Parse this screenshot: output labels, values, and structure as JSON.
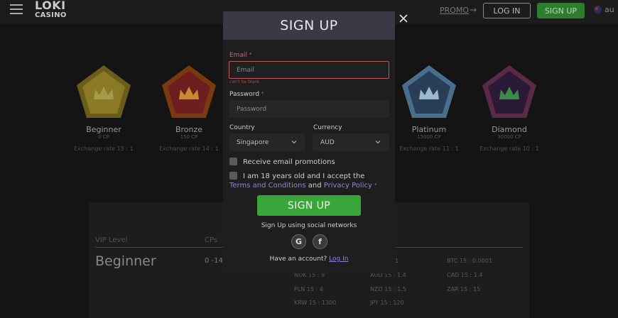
{
  "header": {
    "logo_line1": "LOKI",
    "logo_line2": "CASINO",
    "promo": "PROMO",
    "promo_arrow": "→",
    "login": "LOG IN",
    "signup": "SIGN UP",
    "language": "au"
  },
  "badges": [
    {
      "name": "Beginner",
      "cp": "0 CP",
      "rate": "Exchange rate 15 : 1",
      "color": "#8a7a20"
    },
    {
      "name": "Bronze",
      "cp": "150 CP",
      "rate": "Exchange rate 14 : 1",
      "color": "#9a4a14"
    },
    {
      "name": "Platinum",
      "cp": "15000 CP",
      "rate": "Exchange rate 11 : 1",
      "color": "#5a8ab0"
    },
    {
      "name": "Diamond",
      "cp": "30000 CP",
      "rate": "Exchange rate 10 : 1",
      "color": "#6a2a50"
    }
  ],
  "vip": {
    "header_level": "VIP Level",
    "header_cps": "CPs",
    "level": "Beginner",
    "cps": "0 -149",
    "rates": [
      "1",
      "BTC 15 : 0.0001",
      "NOK 15 : 9",
      "AUD 15 : 1.4",
      "CAD 15 : 1.4",
      "PLN 15 : 4",
      "NZD 15 : 1.5",
      "ZAR 15 : 15",
      "KRW 15 : 1300",
      "JPY 15 : 120"
    ]
  },
  "modal": {
    "title": "SIGN UP",
    "email_label": "Email",
    "required_mark": "*",
    "email_placeholder": "Email",
    "email_error": "can't be blank",
    "password_label": "Password",
    "password_placeholder": "Password",
    "country_label": "Country",
    "country_value": "Singapore",
    "currency_label": "Currency",
    "currency_value": "AUD",
    "promo_check": "Receive email promotions",
    "terms_prefix": "I am 18 years old and I accept the ",
    "terms_link": "Terms and Conditions",
    "terms_and": " and ",
    "privacy_link": "Privacy Policy",
    "submit": "SIGN UP",
    "social_text": "Sign Up using social networks",
    "google": "G",
    "facebook": "f",
    "have_account": "Have an account?",
    "login_link": "Log In"
  }
}
